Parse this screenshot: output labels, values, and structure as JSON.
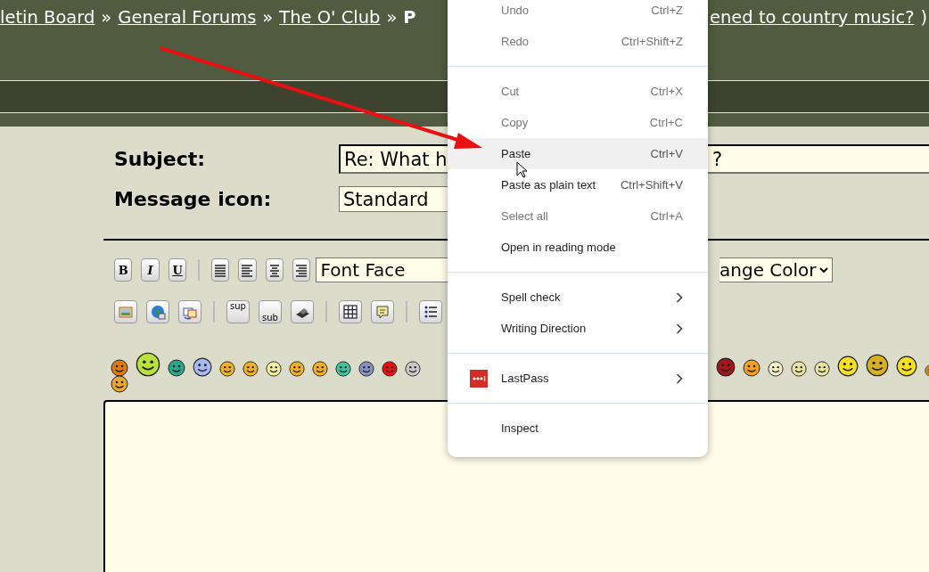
{
  "breadcrumb": [
    {
      "kind": "link",
      "text": "letin Board"
    },
    {
      "kind": "sep",
      "text": "»"
    },
    {
      "kind": "link",
      "text": "General Forums"
    },
    {
      "kind": "sep",
      "text": "»"
    },
    {
      "kind": "link",
      "text": "The O' Club"
    },
    {
      "kind": "sep",
      "text": "»"
    },
    {
      "kind": "current",
      "text": "P"
    }
  ],
  "breadcrumb_right": [
    {
      "kind": "link",
      "text": "ened to country music?"
    },
    {
      "kind": "sep",
      "text": ")"
    }
  ],
  "form": {
    "subject_label": "Subject:",
    "subject_value_start": "Re: What h",
    "subject_value_end": "?",
    "icon_label": "Message icon:",
    "icon_value": "Standard"
  },
  "toolbar_rows": [
    [
      {
        "kind": "bold",
        "text": "B"
      },
      {
        "kind": "italic",
        "text": "I"
      },
      {
        "kind": "underline",
        "text": "U"
      },
      {
        "kind": "divider"
      },
      {
        "kind": "justify"
      },
      {
        "kind": "align-left"
      },
      {
        "kind": "align-center"
      },
      {
        "kind": "align-right"
      },
      {
        "kind": "select",
        "text": "Font Face"
      }
    ],
    [
      {
        "kind": "image"
      },
      {
        "kind": "globe"
      },
      {
        "kind": "swap"
      },
      {
        "kind": "divider"
      },
      {
        "kind": "sup",
        "text": "sup"
      },
      {
        "kind": "sub",
        "text": "sub"
      },
      {
        "kind": "stamp"
      },
      {
        "kind": "divider"
      },
      {
        "kind": "table"
      },
      {
        "kind": "note"
      },
      {
        "kind": "divider"
      },
      {
        "kind": "list"
      }
    ]
  ],
  "color_select": "ange Color",
  "menu": [
    {
      "kind": "item",
      "label": "Undo",
      "shortcut": "Ctrl+Z",
      "disabled": true,
      "selected": false
    },
    {
      "kind": "item",
      "label": "Redo",
      "shortcut": "Ctrl+Shift+Z",
      "disabled": true,
      "selected": false
    },
    {
      "kind": "separator"
    },
    {
      "kind": "item",
      "label": "Cut",
      "shortcut": "Ctrl+X",
      "disabled": true,
      "selected": false
    },
    {
      "kind": "item",
      "label": "Copy",
      "shortcut": "Ctrl+C",
      "disabled": true,
      "selected": false
    },
    {
      "kind": "item",
      "label": "Paste",
      "shortcut": "Ctrl+V",
      "disabled": false,
      "selected": true
    },
    {
      "kind": "item",
      "label": "Paste as plain text",
      "shortcut": "Ctrl+Shift+V",
      "disabled": false,
      "selected": false
    },
    {
      "kind": "item",
      "label": "Select all",
      "shortcut": "Ctrl+A",
      "disabled": true,
      "selected": false
    },
    {
      "kind": "item",
      "label": "Open in reading mode",
      "disabled": false,
      "selected": false
    },
    {
      "kind": "separator"
    },
    {
      "kind": "submenu",
      "label": "Spell check",
      "disabled": false,
      "selected": false
    },
    {
      "kind": "submenu",
      "label": "Writing Direction",
      "disabled": false,
      "selected": false
    },
    {
      "kind": "separator"
    },
    {
      "kind": "app-submenu",
      "label": "LastPass",
      "disabled": false,
      "selected": false
    },
    {
      "kind": "separator"
    },
    {
      "kind": "item",
      "label": "Inspect",
      "disabled": false,
      "selected": false
    }
  ]
}
